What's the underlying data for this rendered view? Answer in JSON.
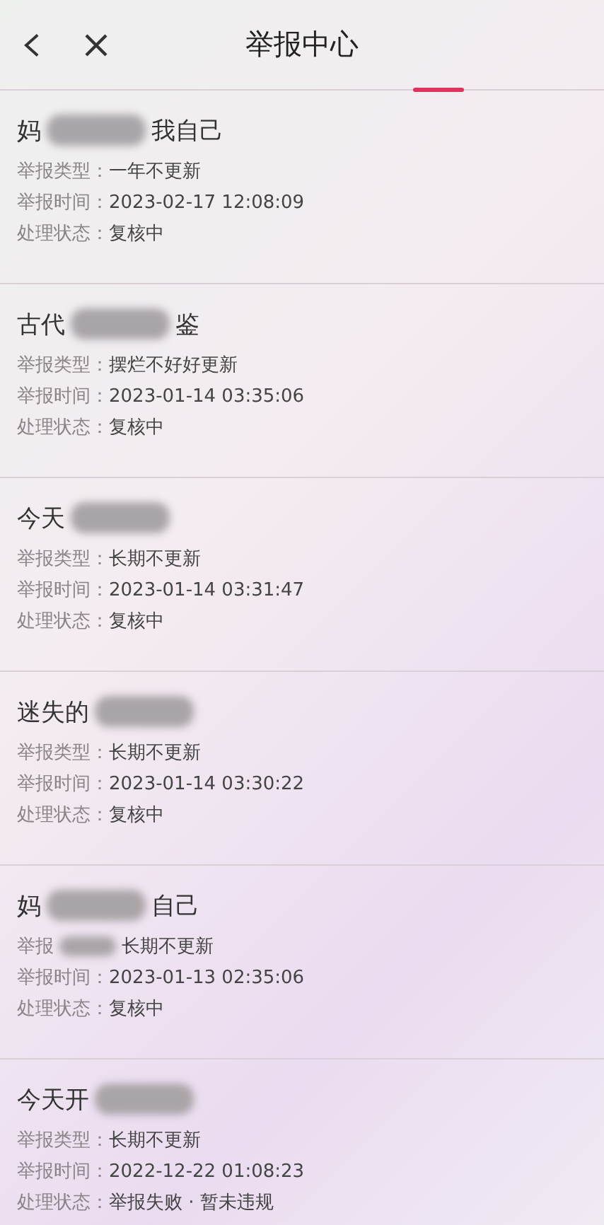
{
  "header": {
    "title": "举报中心"
  },
  "reports": [
    {
      "title_parts": [
        "妈",
        "我自己"
      ],
      "rows": [
        {
          "label": "举报类型：",
          "value": "一年不更新",
          "redacted": false
        },
        {
          "label": "举报时间：",
          "value": "2023-02-17 12:08:09",
          "redacted": false
        },
        {
          "label": "处理状态：",
          "value": "复核中",
          "redacted": false
        }
      ]
    },
    {
      "title_parts": [
        "古代",
        "鉴"
      ],
      "rows": [
        {
          "label": "举报类型：",
          "value": "摆烂不好好更新",
          "redacted": false
        },
        {
          "label": "举报时间：",
          "value": "2023-01-14 03:35:06",
          "redacted": false
        },
        {
          "label": "处理状态：",
          "value": "复核中",
          "redacted": false
        }
      ]
    },
    {
      "title_parts": [
        "今天"
      ],
      "rows": [
        {
          "label": "举报类型：",
          "value": "长期不更新",
          "redacted": false
        },
        {
          "label": "举报时间：",
          "value": "2023-01-14 03:31:47",
          "redacted": false
        },
        {
          "label": "处理状态：",
          "value": "复核中",
          "redacted": false
        }
      ]
    },
    {
      "title_parts": [
        "迷失的"
      ],
      "rows": [
        {
          "label": "举报类型：",
          "value": "长期不更新",
          "redacted": false
        },
        {
          "label": "举报时间：",
          "value": "2023-01-14 03:30:22",
          "redacted": false
        },
        {
          "label": "处理状态：",
          "value": "复核中",
          "redacted": false
        }
      ]
    },
    {
      "title_parts": [
        "妈",
        "自己"
      ],
      "rows": [
        {
          "label": "举报",
          "value": "长期不更新",
          "redacted": true
        },
        {
          "label": "举报时间：",
          "value": "2023-01-13 02:35:06",
          "redacted": false
        },
        {
          "label": "处理状态：",
          "value": "复核中",
          "redacted": false
        }
      ]
    },
    {
      "title_parts": [
        "今天开"
      ],
      "rows": [
        {
          "label": "举报类型：",
          "value": "长期不更新",
          "redacted": false
        },
        {
          "label": "举报时间：",
          "value": "2022-12-22 01:08:23",
          "redacted": false
        },
        {
          "label": "处理状态：",
          "value": "举报失败 · 暂未违规",
          "redacted": false
        }
      ]
    }
  ]
}
